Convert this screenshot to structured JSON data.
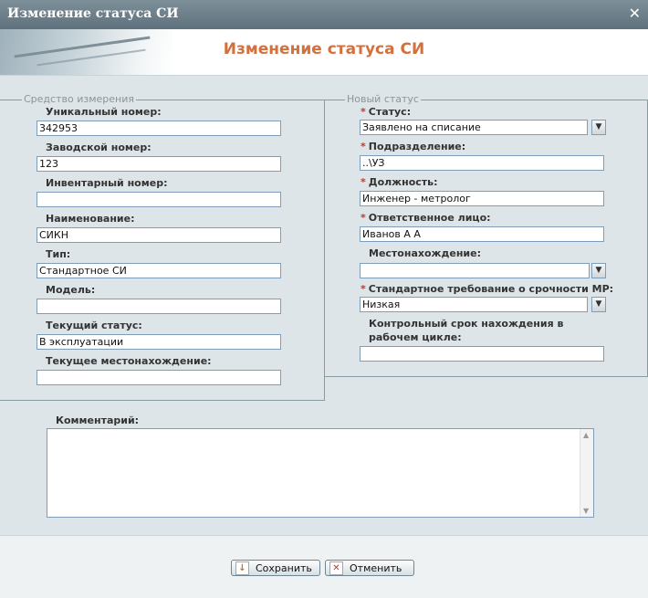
{
  "window": {
    "title": "Изменение статуса СИ",
    "close": "✕"
  },
  "header": {
    "title": "Изменение статуса СИ"
  },
  "left": {
    "legend": "Средство измерения",
    "fields": [
      {
        "label": "Уникальный номер:",
        "value": "342953"
      },
      {
        "label": "Заводской номер:",
        "value": "123"
      },
      {
        "label": "Инвентарный номер:",
        "value": ""
      },
      {
        "label": "Наименование:",
        "value": "СИКН"
      },
      {
        "label": "Тип:",
        "value": "Стандартное СИ"
      },
      {
        "label": "Модель:",
        "value": ""
      },
      {
        "label": "Текущий статус:",
        "value": "В эксплуатации"
      },
      {
        "label": "Текущее местонахождение:",
        "value": ""
      }
    ]
  },
  "right": {
    "legend": "Новый статус",
    "required_mark": "*",
    "status": {
      "label": "Статус:",
      "value": "Заявлено на списание"
    },
    "division": {
      "label": "Подразделение:",
      "value": "..\\УЗ"
    },
    "position": {
      "label": "Должность:",
      "value": "Инженер - метролог"
    },
    "responsible": {
      "label": "Ответственное лицо:",
      "value": "Иванов А А"
    },
    "location": {
      "label": "Местонахождение:",
      "value": ""
    },
    "urgency": {
      "label": "Стандартное требование о срочности МР:",
      "value": "Низкая"
    },
    "deadline": {
      "label_line1": "Контрольный срок нахождения в",
      "label_line2": "рабочем цикле:",
      "value": ""
    }
  },
  "comment": {
    "label": "Комментарий:",
    "value": ""
  },
  "buttons": {
    "save": "Сохранить",
    "cancel": "Отменить"
  },
  "icons": {
    "dropdown": "▼",
    "scroll_up": "▲",
    "scroll_down": "▼"
  }
}
